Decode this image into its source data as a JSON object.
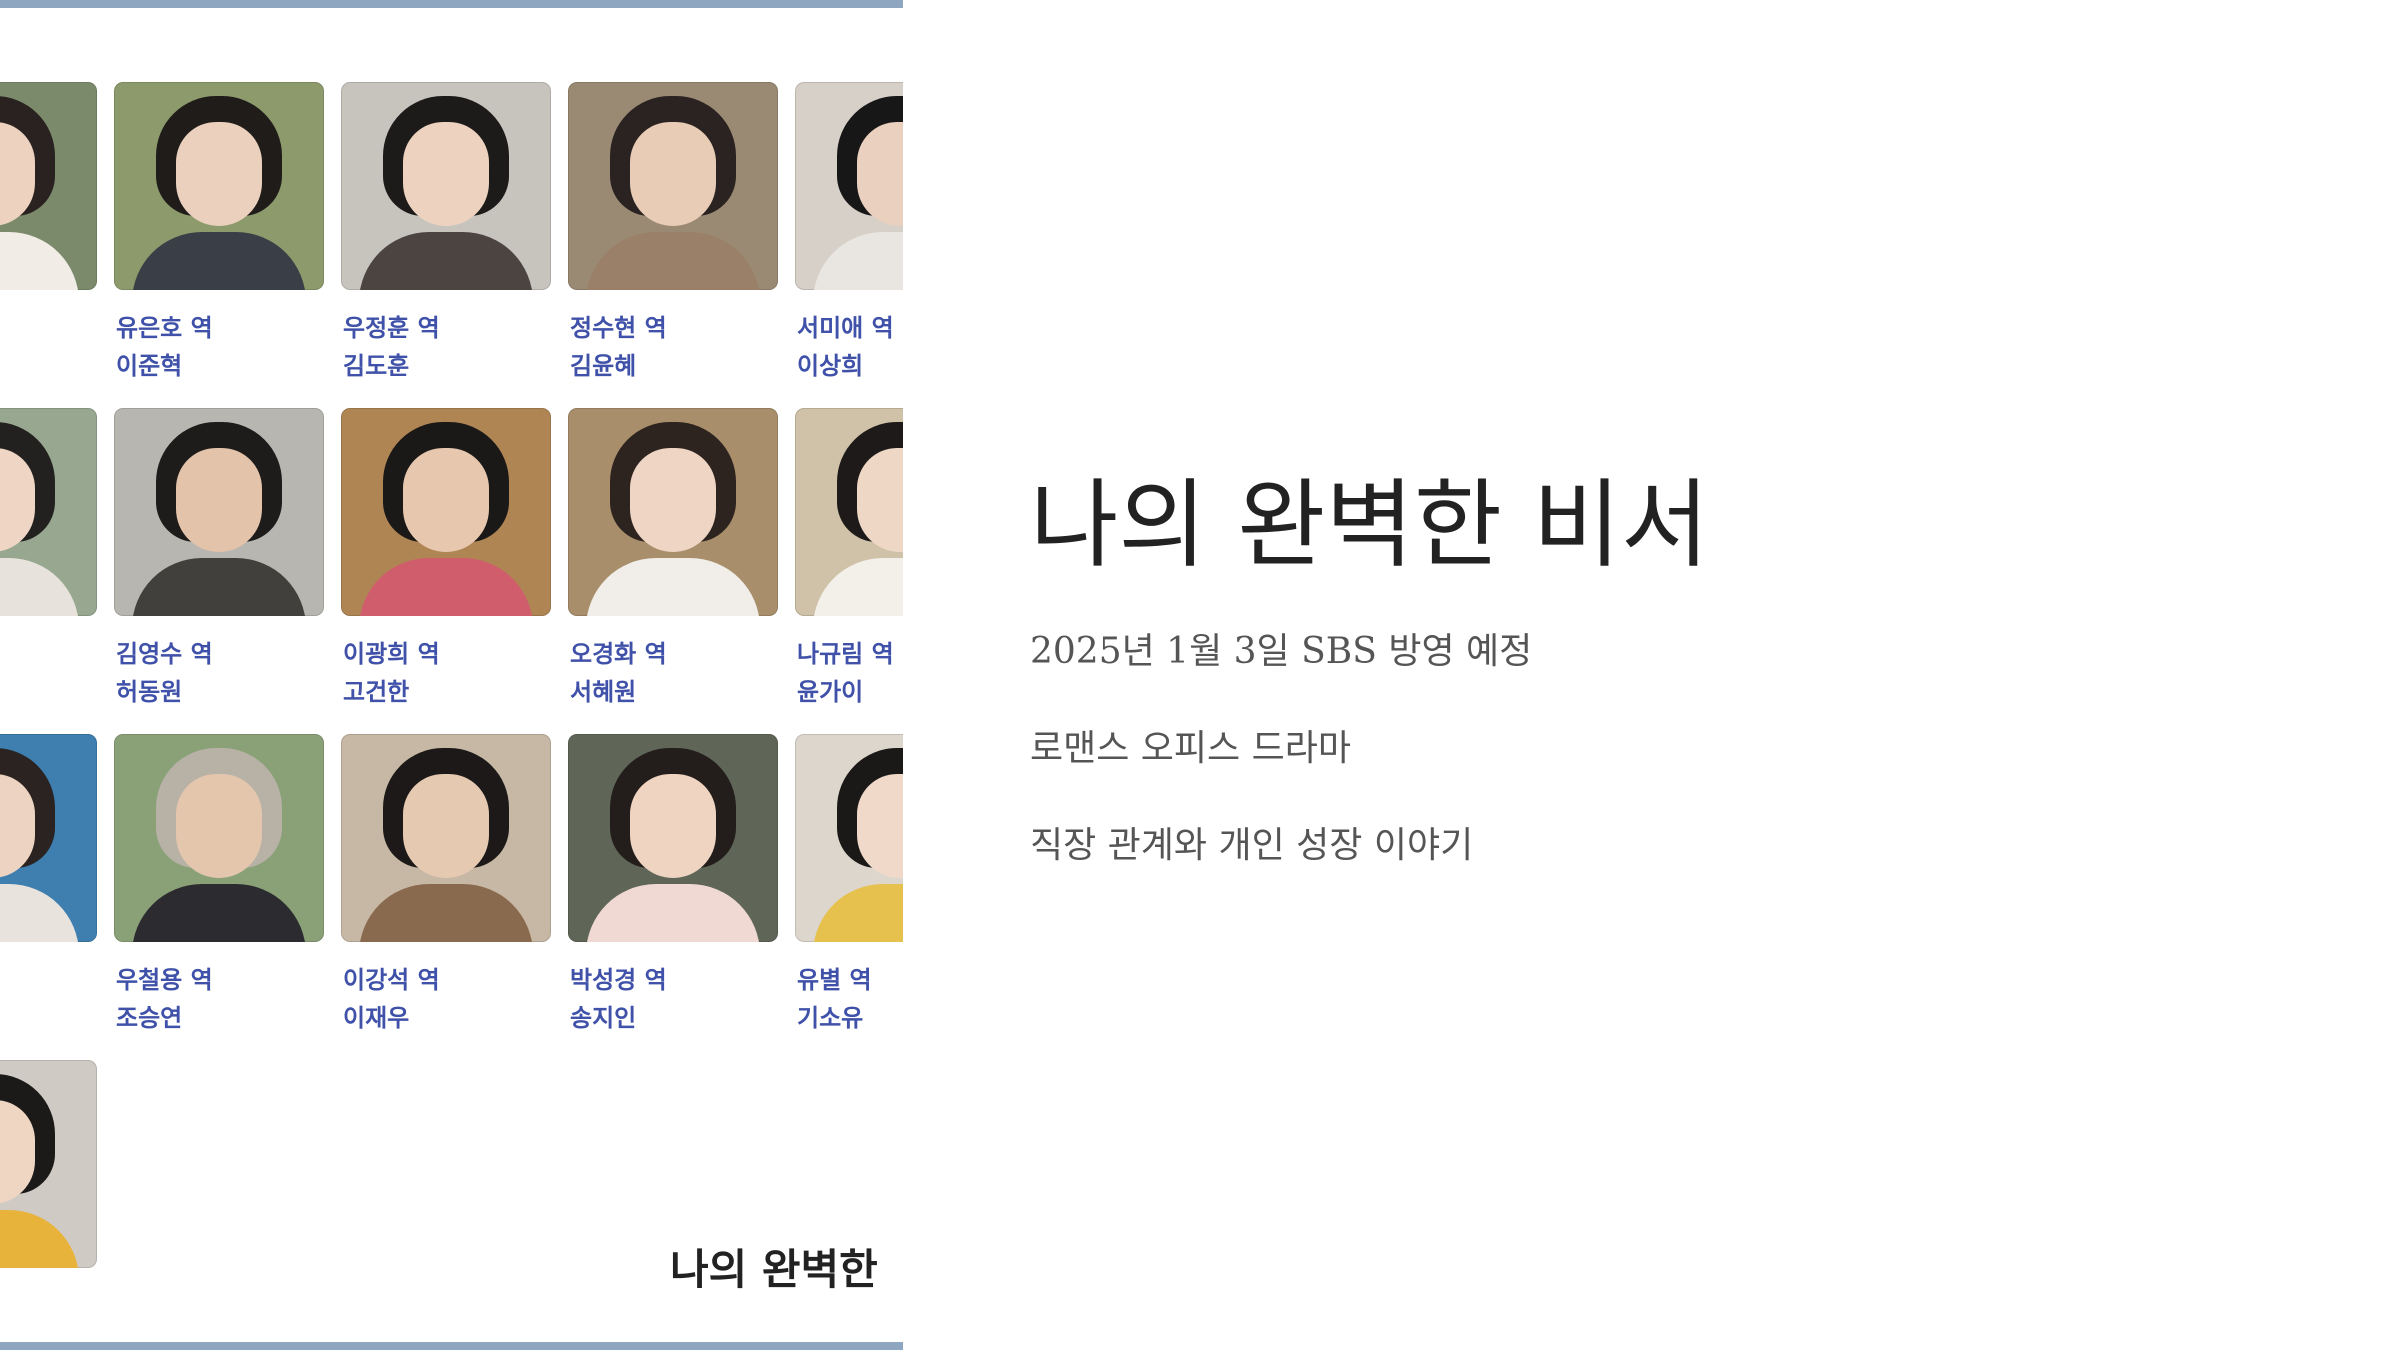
{
  "drama": {
    "title": "나의 완벽한 비서",
    "broadcast": "2025년 1월 3일 SBS 방영 예정",
    "genre": "로맨스 오피스 드라마",
    "theme": "직장 관계와 개인 성장 이야기"
  },
  "poster": {
    "watermark": "나의 완벽한"
  },
  "cast": [
    {
      "role": "",
      "actor": "",
      "photo_palette": {
        "bg": "#7a8a6a",
        "hair": "#2a2220",
        "skin": "#ecd2bf",
        "clothes": "#f1ece6"
      }
    },
    {
      "role": "유은호 역",
      "actor": "이준혁",
      "photo_palette": {
        "bg": "#8c9a6c",
        "hair": "#1f1c1a",
        "skin": "#ead0bd",
        "clothes": "#3a3e47"
      }
    },
    {
      "role": "우정훈 역",
      "actor": "김도훈",
      "photo_palette": {
        "bg": "#c7c3bd",
        "hair": "#1d1b1a",
        "skin": "#edd3bf",
        "clothes": "#4b4440"
      }
    },
    {
      "role": "정수현 역",
      "actor": "김윤혜",
      "photo_palette": {
        "bg": "#9b8a73",
        "hair": "#2b2321",
        "skin": "#e8ccb6",
        "clothes": "#9a8068"
      }
    },
    {
      "role": "서미애 역",
      "actor": "이상희",
      "photo_palette": {
        "bg": "#d6d0c8",
        "hair": "#181717",
        "skin": "#ead0bf",
        "clothes": "#e9e6e1"
      }
    },
    {
      "role": "",
      "actor": "",
      "photo_palette": {
        "bg": "#98a890",
        "hair": "#232020",
        "skin": "#efd6c4",
        "clothes": "#e7e2db"
      }
    },
    {
      "role": "김영수 역",
      "actor": "허동원",
      "photo_palette": {
        "bg": "#b7b6b0",
        "hair": "#1e1c1b",
        "skin": "#e3c3aa",
        "clothes": "#42403c"
      }
    },
    {
      "role": "이광희 역",
      "actor": "고건한",
      "photo_palette": {
        "bg": "#b08554",
        "hair": "#1b1918",
        "skin": "#e7c8ae",
        "clothes": "#cf5d6b"
      }
    },
    {
      "role": "오경화 역",
      "actor": "서혜원",
      "photo_palette": {
        "bg": "#a88e6a",
        "hair": "#2d231f",
        "skin": "#efd5c3",
        "clothes": "#f1ede8"
      }
    },
    {
      "role": "나규림 역",
      "actor": "윤가이",
      "photo_palette": {
        "bg": "#cfc2a8",
        "hair": "#1d1a19",
        "skin": "#efd7c6",
        "clothes": "#f3efe9"
      }
    },
    {
      "role": "",
      "actor": "",
      "photo_palette": {
        "bg": "#3e7fb0",
        "hair": "#2a2321",
        "skin": "#edd4c2",
        "clothes": "#e8e3dd"
      }
    },
    {
      "role": "우철용 역",
      "actor": "조승연",
      "photo_palette": {
        "bg": "#8aa178",
        "hair": "#b8b2a6",
        "skin": "#e4c6ad",
        "clothes": "#2c2c30"
      }
    },
    {
      "role": "이강석 역",
      "actor": "이재우",
      "photo_palette": {
        "bg": "#c6b8a4",
        "hair": "#1c1918",
        "skin": "#e6c9b1",
        "clothes": "#8a6a4e"
      }
    },
    {
      "role": "박성경 역",
      "actor": "송지인",
      "photo_palette": {
        "bg": "#5f6658",
        "hair": "#231d1b",
        "skin": "#eed4c1",
        "clothes": "#f0d9d2"
      }
    },
    {
      "role": "유별 역",
      "actor": "기소유",
      "photo_palette": {
        "bg": "#dcd6cd",
        "hair": "#1b1918",
        "skin": "#f0d9c8",
        "clothes": "#e7c14e"
      }
    },
    {
      "role": "",
      "actor": "",
      "photo_palette": {
        "bg": "#cfcac3",
        "hair": "#1c1a19",
        "skin": "#efd6c3",
        "clothes": "#e8b33a"
      }
    }
  ],
  "colors": {
    "panel_border": "#8ea6c0",
    "cast_text": "#3f51a8",
    "title_text": "#222222",
    "body_text": "#555555"
  }
}
